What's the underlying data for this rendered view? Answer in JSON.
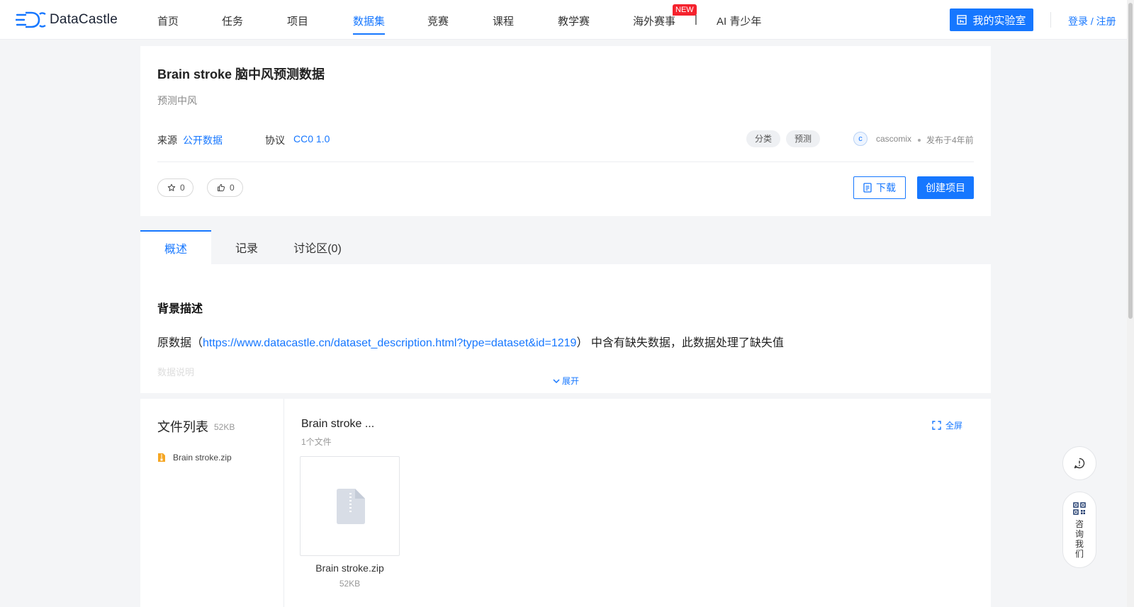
{
  "brand": {
    "name": "DataCastle"
  },
  "nav": {
    "items": [
      {
        "label": "首页"
      },
      {
        "label": "任务"
      },
      {
        "label": "项目"
      },
      {
        "label": "数据集"
      },
      {
        "label": "竞赛"
      },
      {
        "label": "课程"
      },
      {
        "label": "教学赛"
      },
      {
        "label": "海外赛事"
      },
      {
        "label": "AI 青少年"
      }
    ],
    "active_index": 3,
    "new_badge": "NEW",
    "separator": "|",
    "lab_button": "我的实验室",
    "login": "登录 / 注册"
  },
  "dataset": {
    "title": "Brain stroke 脑中风预测数据",
    "subtitle": "预测中风",
    "source_label": "来源",
    "source_value": "公开数据",
    "license_label": "协议",
    "license_value": "CC0 1.0",
    "tags": [
      "分类",
      "预测"
    ],
    "author_initial": "c",
    "author": "cascomix",
    "published": "发布于4年前",
    "favorites": "0",
    "likes": "0",
    "download_label": "下载",
    "create_project_label": "创建项目"
  },
  "tabs": [
    {
      "label": "概述"
    },
    {
      "label": "记录"
    },
    {
      "label": "讨论区(0)"
    }
  ],
  "overview": {
    "heading": "背景描述",
    "text_prefix": "原数据（",
    "link": "https://www.datacastle.cn/dataset_description.html?type=dataset&id=1219",
    "text_suffix": "） 中含有缺失数据，此数据处理了缺失值",
    "faded_next_line": "数据说明",
    "expand_label": "展开"
  },
  "files": {
    "title": "文件列表",
    "total_size": "52KB",
    "list": [
      {
        "name": "Brain stroke.zip"
      }
    ],
    "folder_title": "Brain stroke ...",
    "folder_count": "1个文件",
    "fullscreen_label": "全屏",
    "tile_name": "Brain stroke.zip",
    "tile_size": "52KB"
  },
  "floating": {
    "consult_label": "咨询我们"
  },
  "colors": {
    "primary": "#1677ff",
    "new_badge": "#f5222d",
    "page_bg": "#f4f5f7",
    "zip_icon": "#f5a623"
  },
  "icons": {
    "logo": "datacastle-logo-icon",
    "lab": "lab-icon",
    "star": "star-icon",
    "like": "thumbs-up-icon",
    "download": "document-icon",
    "expand": "chevron-down-icon",
    "zip": "zip-file-icon",
    "fullscreen": "fullscreen-icon",
    "feedback": "feedback-icon",
    "qr": "qr-code-icon"
  }
}
